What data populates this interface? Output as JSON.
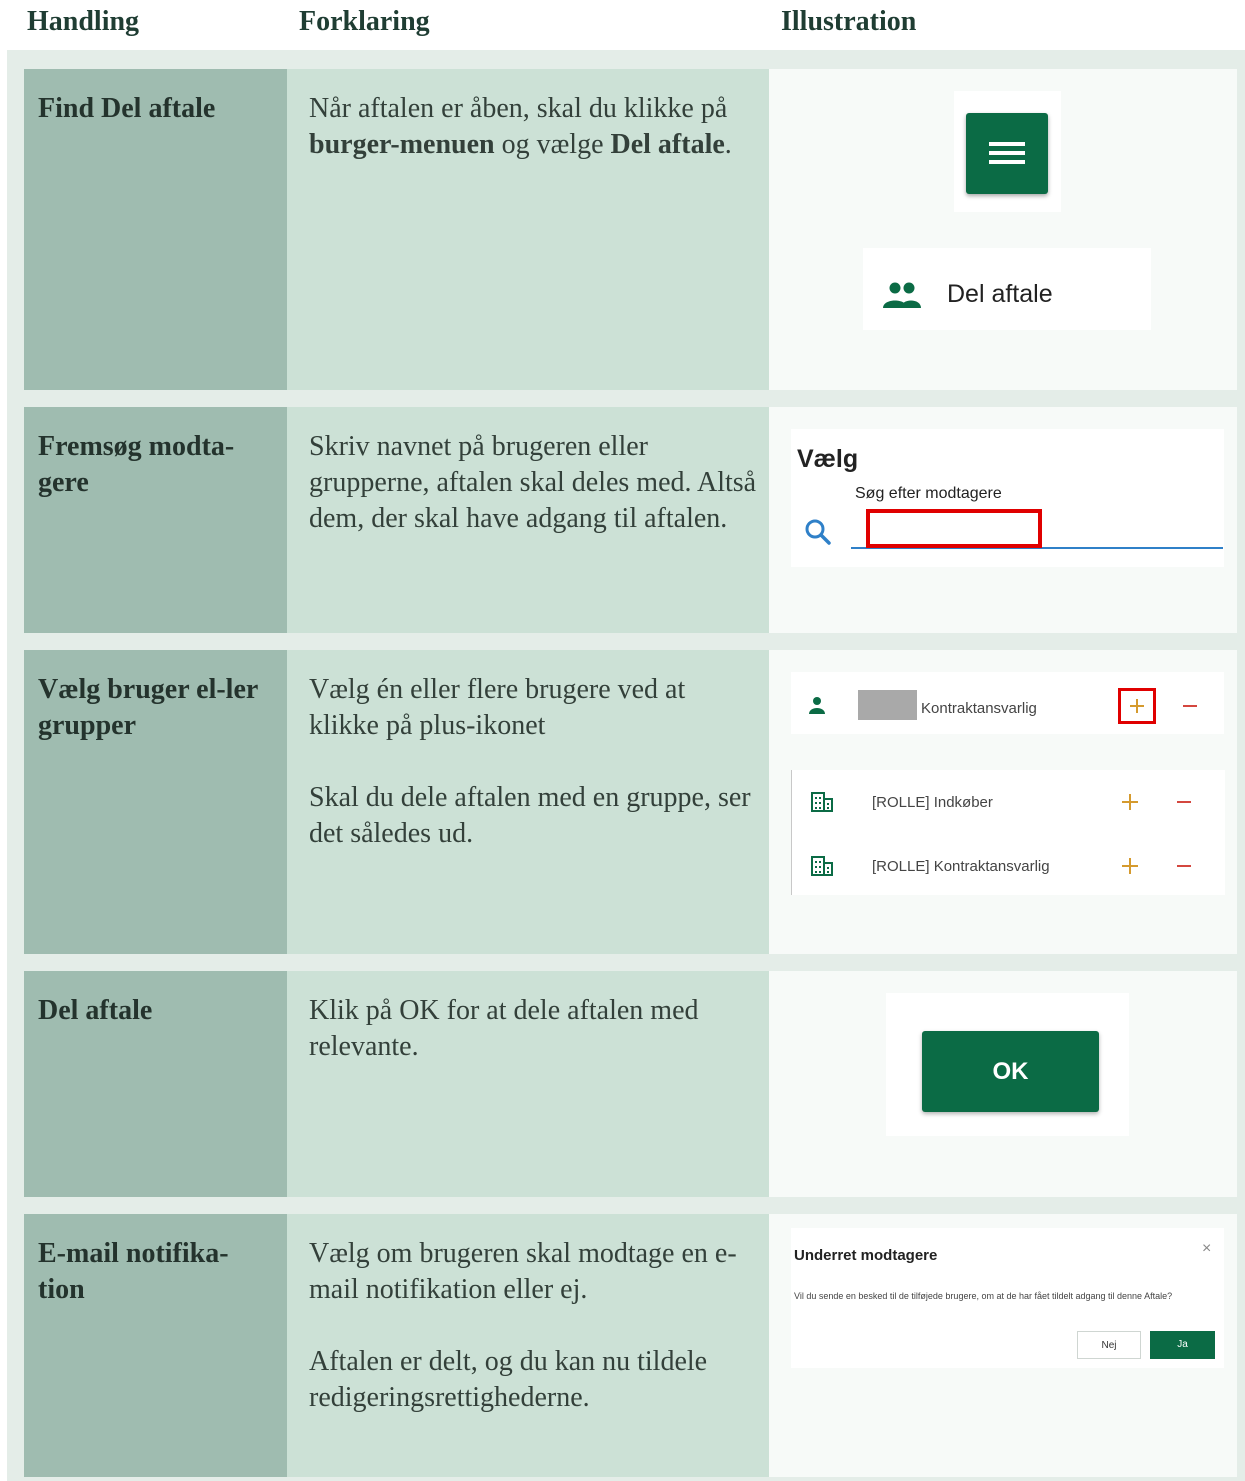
{
  "header": {
    "col1": "Handling",
    "col2": "Forklaring",
    "col3": "Illustration"
  },
  "rows": [
    {
      "title": "Find Del aftale",
      "text": [
        [
          "Når aftalen er åben, skal du klikke på ",
          "burger-menuen",
          " og vælge ",
          "Del aftale",
          "."
        ]
      ],
      "illustration": {
        "menu_item": "Del aftale",
        "icons": [
          "burger-menu-icon",
          "people-icon"
        ]
      }
    },
    {
      "title": "Fremsøg modta-gere",
      "text": [
        "Skriv navnet på brugeren eller grupperne, aftalen skal deles med. Altså dem, der skal have adgang til aftalen."
      ],
      "illustration": {
        "heading": "Vælg",
        "field_label": "Søg efter modtagere",
        "icons": [
          "search-icon"
        ],
        "accent": "#2f80c8",
        "highlight": "#e00000"
      }
    },
    {
      "title": "Vælg bruger el-ler grupper",
      "text": [
        "Vælg én eller flere brugere ved at klikke på plus-ikonet",
        "Skal du dele aftalen med en gruppe, ser det således ud."
      ],
      "illustration": {
        "user_role": "Kontraktansvarlig",
        "groups": [
          "[ROLLE] Indkøber",
          "[ROLLE] Kontraktansvarlig"
        ],
        "icons": [
          "person-icon",
          "building-icon",
          "plus-icon",
          "minus-icon"
        ],
        "plus_color": "#d59a2e",
        "minus_color": "#d4473f"
      }
    },
    {
      "title": "Del aftale",
      "text": [
        "Klik på OK for at dele aftalen med relevante."
      ],
      "illustration": {
        "button": "OK"
      }
    },
    {
      "title": "E-mail notifika-tion",
      "text": [
        "Vælg om brugeren skal modtage en e-mail notifikation eller ej.",
        "Aftalen er delt, og du kan nu tildele redigeringsrettighederne."
      ],
      "illustration": {
        "dialog_title": "Underret modtagere",
        "dialog_text": "Vil du sende en besked til de tilføjede brugere, om at de har fået tildelt adgang til denne Aftale?",
        "no_label": "Nej",
        "yes_label": "Ja",
        "close_glyph": "×"
      }
    }
  ],
  "colors": {
    "brand_green": "#0b6b45",
    "title_cell": "#9fbcb0",
    "text_cell": "#cce1d6"
  }
}
